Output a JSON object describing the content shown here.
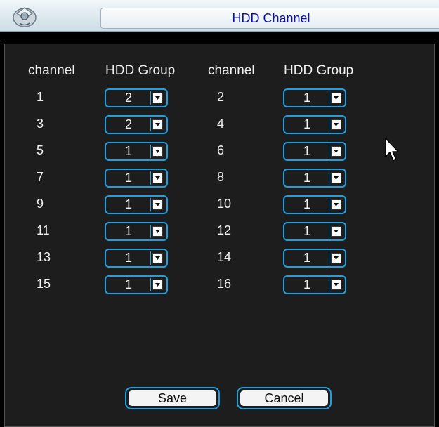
{
  "window": {
    "title": "HDD Channel"
  },
  "headers": {
    "left_channel": "channel",
    "left_group": "HDD Group",
    "right_channel": "channel",
    "right_group": "HDD Group"
  },
  "rows": [
    {
      "left_channel": "1",
      "left_group": "2",
      "right_channel": "2",
      "right_group": "1"
    },
    {
      "left_channel": "3",
      "left_group": "2",
      "right_channel": "4",
      "right_group": "1"
    },
    {
      "left_channel": "5",
      "left_group": "1",
      "right_channel": "6",
      "right_group": "1"
    },
    {
      "left_channel": "7",
      "left_group": "1",
      "right_channel": "8",
      "right_group": "1"
    },
    {
      "left_channel": "9",
      "left_group": "1",
      "right_channel": "10",
      "right_group": "1"
    },
    {
      "left_channel": "11",
      "left_group": "1",
      "right_channel": "12",
      "right_group": "1"
    },
    {
      "left_channel": "13",
      "left_group": "1",
      "right_channel": "14",
      "right_group": "1"
    },
    {
      "left_channel": "15",
      "left_group": "1",
      "right_channel": "16",
      "right_group": "1"
    }
  ],
  "buttons": {
    "save_label": "Save",
    "cancel_label": "Cancel"
  },
  "colors": {
    "accent": "#1e9fe0",
    "title_text": "#0f10a0",
    "panel_bg": "#1d1d1d"
  }
}
